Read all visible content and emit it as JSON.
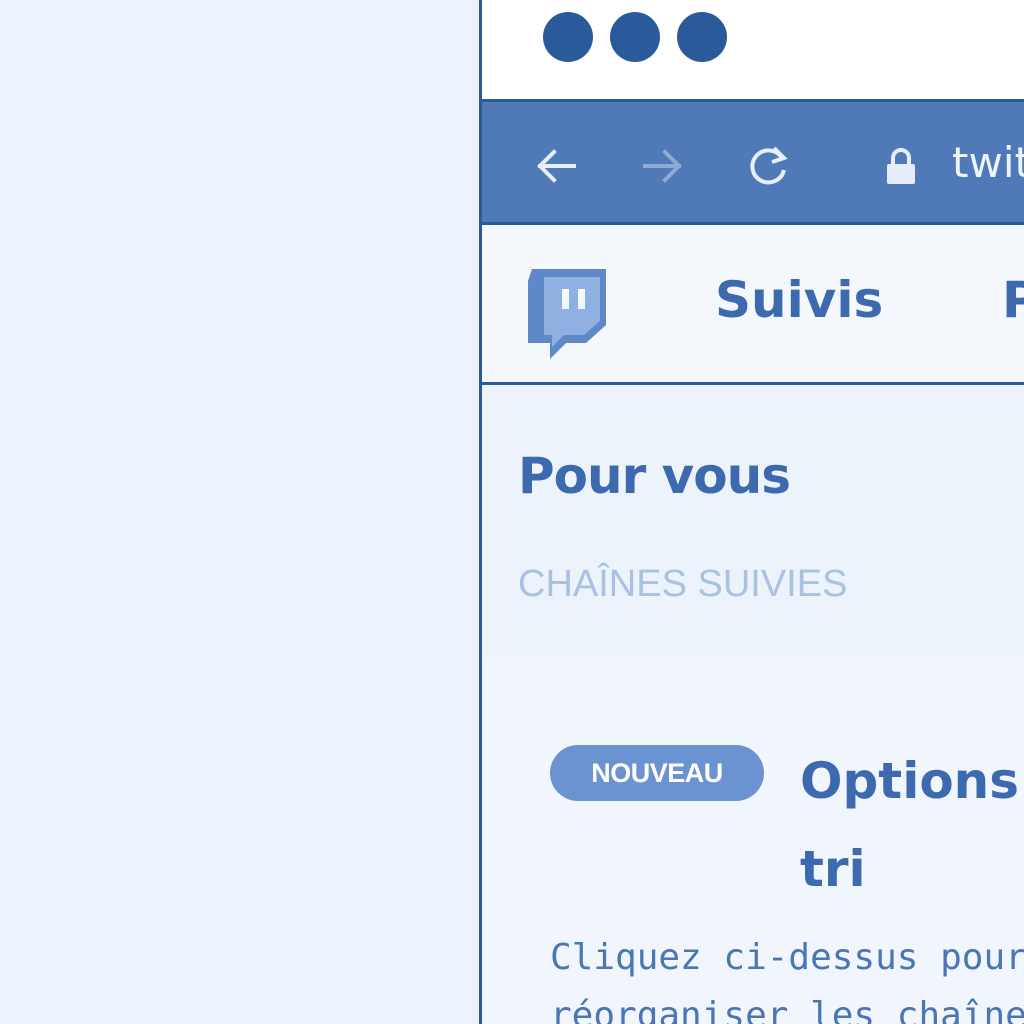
{
  "window": {
    "controls": [
      "close",
      "minimize",
      "maximize"
    ]
  },
  "address_bar": {
    "back_icon": "arrow-left-icon",
    "forward_icon": "arrow-right-icon",
    "reload_icon": "reload-icon",
    "lock_icon": "lock-icon",
    "url": "twit"
  },
  "topnav": {
    "logo_icon": "twitch-logo-icon",
    "following_label": "Suivis",
    "next_label": "P"
  },
  "sidebar": {
    "heading": "Pour vous",
    "section_label": "CHAÎNES SUIVIES"
  },
  "card": {
    "badge": "NOUVEAU",
    "title": "Options tri",
    "description": "Cliquez ci-dessus pour réorganiser les chaînes"
  },
  "colors": {
    "page_background": "#ecf3fc",
    "accent": "#2a5a9a",
    "address_bar": "#4f7ab7",
    "text": "#3d6aae",
    "muted_text": "#a9c1e2",
    "badge": "#6b93d2"
  }
}
